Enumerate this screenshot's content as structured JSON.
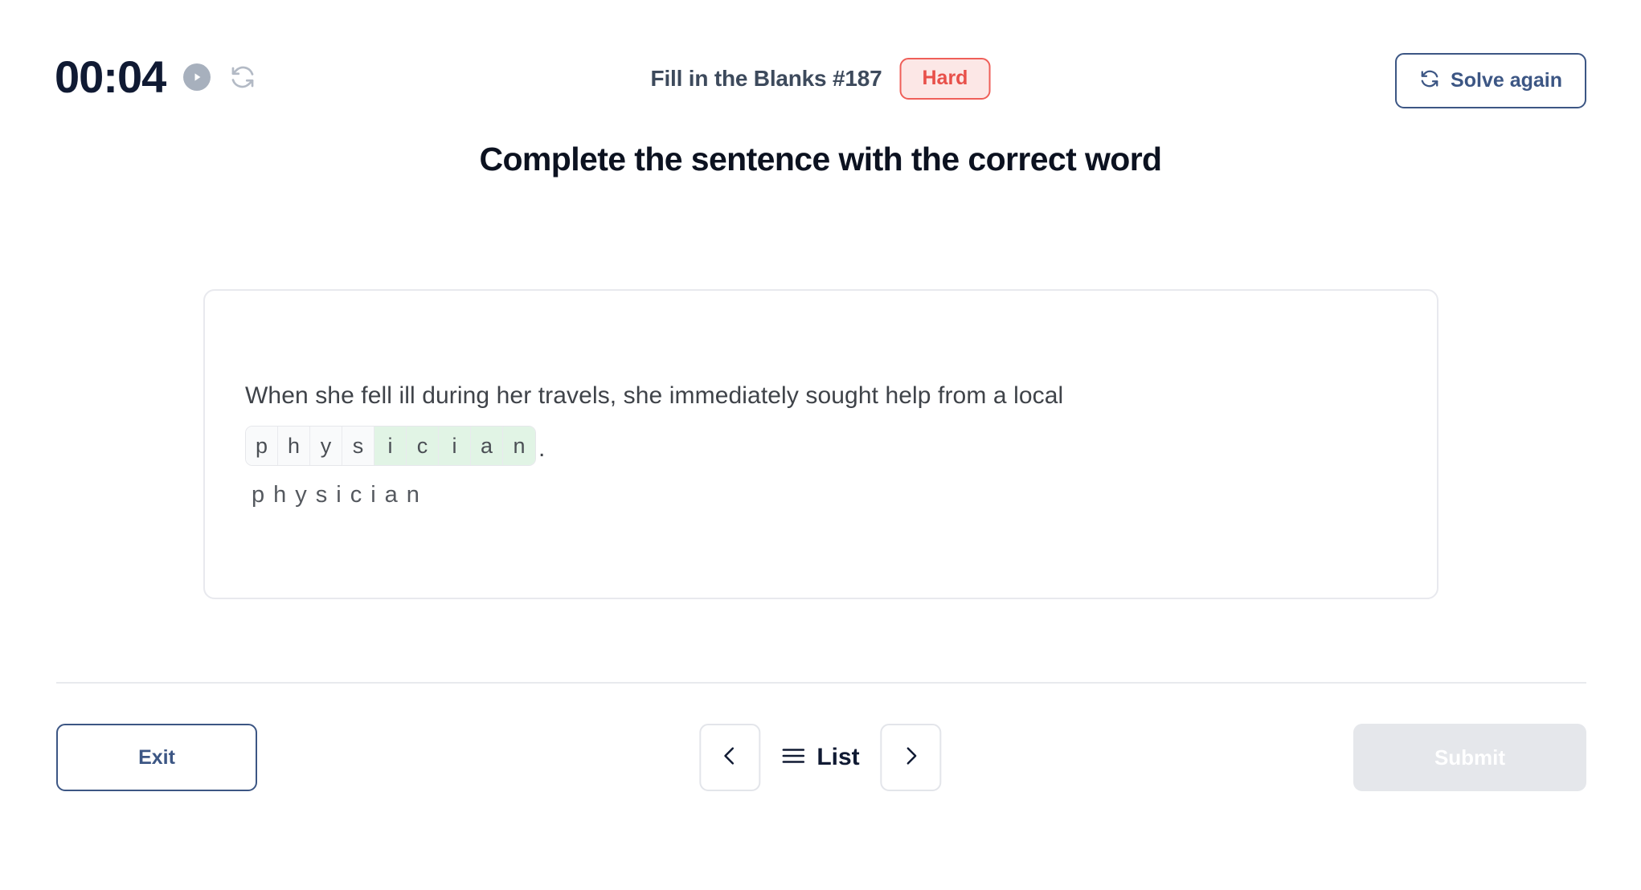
{
  "header": {
    "timer": "00:04",
    "play_icon": "play-icon",
    "reset_icon": "reset-timer-icon",
    "puzzle_title": "Fill in the Blanks #187",
    "difficulty": "Hard",
    "solve_again_label": "Solve again",
    "solve_again_icon": "refresh-icon"
  },
  "main": {
    "heading": "Complete the sentence with the correct word",
    "sentence_prefix": "When she fell ill during her travels, she immediately sought help from a local",
    "trailing_punctuation": ".",
    "answer_word": "physician",
    "letters": [
      {
        "char": "p",
        "state": "plain"
      },
      {
        "char": "h",
        "state": "plain"
      },
      {
        "char": "y",
        "state": "plain"
      },
      {
        "char": "s",
        "state": "plain"
      },
      {
        "char": "i",
        "state": "correct"
      },
      {
        "char": "c",
        "state": "correct"
      },
      {
        "char": "i",
        "state": "correct"
      },
      {
        "char": "a",
        "state": "correct"
      },
      {
        "char": "n",
        "state": "correct"
      }
    ],
    "spelled_out": "physician"
  },
  "footer": {
    "exit_label": "Exit",
    "prev_icon": "chevron-left-icon",
    "list_icon": "hamburger-icon",
    "list_label": "List",
    "next_icon": "chevron-right-icon",
    "submit_label": "Submit"
  },
  "colors": {
    "navy": "#101a33",
    "blue": "#3c5684",
    "danger": "#e8504a",
    "danger_bg": "#fce7e6",
    "correct_bg": "#e1f4e5",
    "muted": "#a7b0bd",
    "disabled_bg": "#e5e7eb"
  }
}
